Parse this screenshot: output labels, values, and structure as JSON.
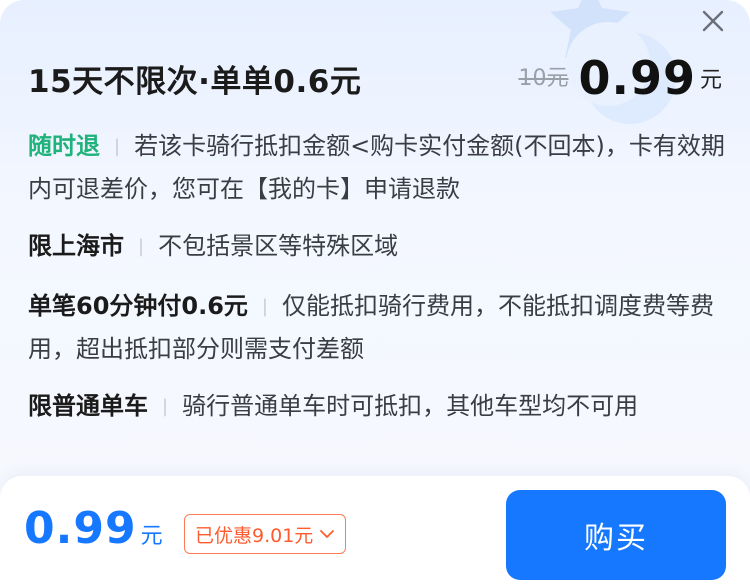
{
  "header": {
    "title": "15天不限次·单单0.6元",
    "original_price": "10元",
    "price": "0.99",
    "unit": "元"
  },
  "rules": [
    {
      "tag": "随时退",
      "text": "若该卡骑行抵扣金额<购卡实付金额(不回本)，卡有效期内可退差价，您可在【我的卡】申请退款"
    },
    {
      "tag": "限上海市",
      "text": "不包括景区等特殊区域"
    },
    {
      "tag": "单笔60分钟付0.6元",
      "text": "仅能抵扣骑行费用，不能抵扣调度费等费用，超出抵扣部分则需支付差额"
    },
    {
      "tag": "限普通单车",
      "text": "骑行普通单车时可抵扣，其他车型均不可用"
    }
  ],
  "footer": {
    "price": "0.99",
    "unit": "元",
    "discount_label": "已优惠9.01元",
    "buy_label": "购买"
  },
  "icons": {
    "close": "close-icon",
    "decoration": "star-moon-icon",
    "discount_toggle": "chevron-down-icon"
  },
  "colors": {
    "accent": "#1677ff",
    "refund_tag": "#1fb37b",
    "discount": "#ff5b2e",
    "background_top": "#e7f0ff"
  }
}
